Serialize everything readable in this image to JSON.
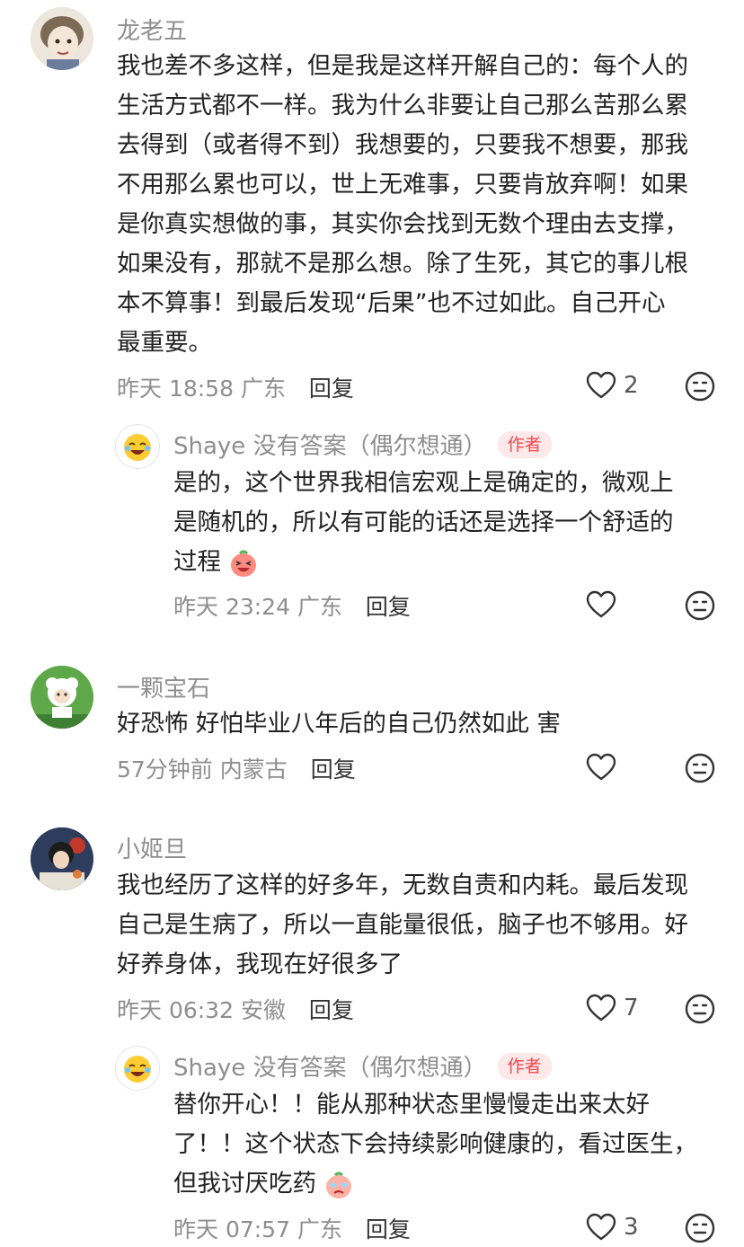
{
  "comments": [
    {
      "name": "龙老五",
      "lines": [
        "我也差不多这样，但是我是这样开解自己的：每个人的",
        "生活方式都不一样。我为什么非要让自己那么苦那么累",
        "去得到（或者得不到）我想要的，只要我不想要，那我",
        "不用那么累也可以，世上无难事，只要肯放弃啊！如果",
        "是你真实想做的事，其实你会找到无数个理由去支撑，",
        "如果没有，那就不是那么想。除了生死，其它的事儿根",
        "本不算事！到最后发现“后果”也不过如此。自己开心",
        "最重要。"
      ],
      "time": "昨天 18:58",
      "location": "广东",
      "reply_label": "回复",
      "like_count": "2"
    },
    {
      "name": "Shaye 没有答案（偶尔想通）",
      "author_tag": "作者",
      "lines": [
        "是的，这个世界我相信宏观上是确定的，微观上",
        "是随机的，所以有可能的话还是选择一个舒适的",
        "过程"
      ],
      "time": "昨天 23:24",
      "location": "广东",
      "reply_label": "回复",
      "like_count": ""
    },
    {
      "name": "一颗宝石",
      "lines": [
        "好恐怖 好怕毕业八年后的自己仍然如此 害"
      ],
      "time": "57分钟前",
      "location": "内蒙古",
      "reply_label": "回复",
      "like_count": ""
    },
    {
      "name": "小姬旦",
      "lines": [
        "我也经历了这样的好多年，无数自责和内耗。最后发现",
        "自己是生病了，所以一直能量很低，脑子也不够用。好",
        "好养身体，我现在好很多了"
      ],
      "time": "昨天 06:32",
      "location": "安徽",
      "reply_label": "回复",
      "like_count": "7"
    },
    {
      "name": "Shaye 没有答案（偶尔想通）",
      "author_tag": "作者",
      "lines": [
        "替你开心！！能从那种状态里慢慢走出来太好",
        "了！！这个状态下会持续影响健康的，看过医生，",
        "但我讨厌吃药"
      ],
      "time": "昨天 07:57",
      "location": "广东",
      "reply_label": "回复",
      "like_count": "3"
    }
  ],
  "colors": {
    "name": "#8e8e8e",
    "text": "#222222",
    "author_tag_bg": "#fde8ea",
    "author_tag_text": "#f0464b"
  },
  "icons": [
    "heart-outline-icon",
    "dislike-face-icon",
    "laughing-emoji-icon",
    "sad-emoji-icon"
  ]
}
